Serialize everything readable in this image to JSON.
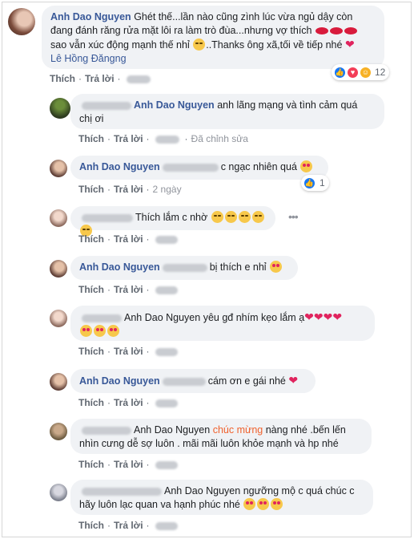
{
  "actions": {
    "like": "Thích",
    "reply": "Trả lời",
    "sep": "·",
    "edited": "Đã chỉnh sửa"
  },
  "comments": [
    {
      "author": "Anh Dao Nguyen",
      "text_1": "Ghét thế...lần nào cũng zình lúc vừa ngủ dậy còn",
      "text_2": "đang đánh răng rửa mặt lôi ra làm trò đùa...nhưng vợ thích",
      "text_3": "sao vẫn xúc động mạnh thế nhỉ",
      "text_3b": "..Thanks ông xã,tối về tiếp nhé",
      "tag": "Lê Hồng Đăngng",
      "reaction_count": "12"
    },
    {
      "text_1": "anh lãng mạng và tình cảm quá",
      "text_2": "chị ơi",
      "mention": "Anh Dao Nguyen"
    },
    {
      "author": "Anh Dao Nguyen",
      "text": "c ngạc nhiên quá",
      "time": "2 ngày",
      "reaction_count": "1"
    },
    {
      "text": "Thích lắm c nhờ"
    },
    {
      "author": "Anh Dao Nguyen",
      "text": "bị thích e nhỉ"
    },
    {
      "mention": "Anh Dao Nguyen",
      "text": "yêu gđ nhím kẹo lắm ạ"
    },
    {
      "author": "Anh Dao Nguyen",
      "text": "cám ơn e gái nhé"
    },
    {
      "mention": "Anh Dao Nguyen",
      "highlight": "chúc mừng",
      "text_1": "nàng nhé .bến lến",
      "text_2": "nhìn cưng dễ sợ luôn . mãi mãi luôn khỏe mạnh và hp nhé"
    },
    {
      "mention": "Anh Dao Nguyen",
      "text_1": "ngưỡng mộ c quá chúc c",
      "text_2": "hãy luôn lạc quan va hạnh phúc nhé"
    }
  ],
  "more_icon": "more-horizontal-icon",
  "colors": {
    "name": "#385898",
    "bubble": "#f0f2f5",
    "highlight": "#f0612d"
  }
}
